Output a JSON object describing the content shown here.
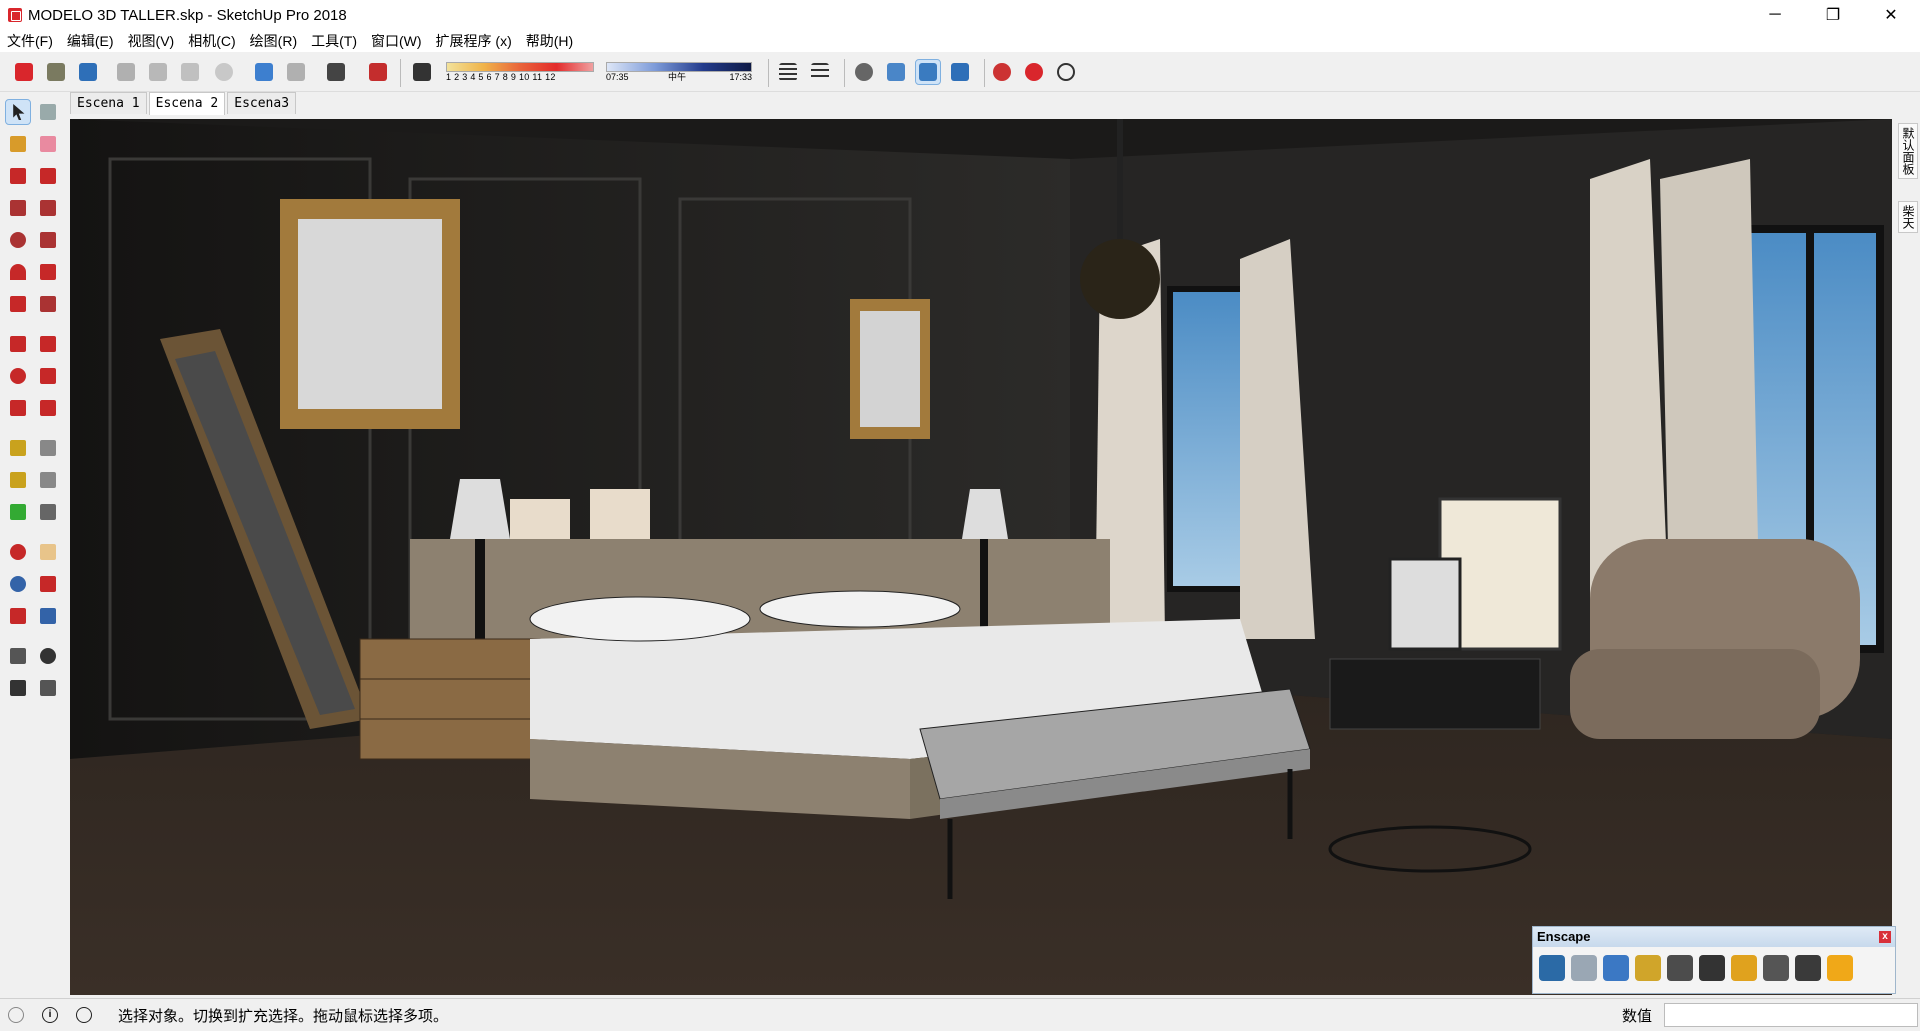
{
  "app": {
    "title": "MODELO 3D TALLER.skp - SketchUp Pro 2018"
  },
  "window_controls": {
    "minimize": "─",
    "maximize": "❐",
    "close": "✕"
  },
  "menu": [
    {
      "label": "文件(F)"
    },
    {
      "label": "编辑(E)"
    },
    {
      "label": "视图(V)"
    },
    {
      "label": "相机(C)"
    },
    {
      "label": "绘图(R)"
    },
    {
      "label": "工具(T)"
    },
    {
      "label": "窗口(W)"
    },
    {
      "label": "扩展程序 (x)"
    },
    {
      "label": "帮助(H)"
    }
  ],
  "shadow": {
    "months": "1 2 3 4 5 6 7 8 9 10 11 12",
    "time_start": "07:35",
    "time_mid": "中午",
    "time_end": "17:33"
  },
  "scenes": [
    {
      "label": "Escena 1",
      "active": false
    },
    {
      "label": "Escena 2",
      "active": true
    },
    {
      "label": "Escena3",
      "active": false
    }
  ],
  "right_panel": {
    "tab1": "默认面板",
    "tab2": "柴天"
  },
  "enscape": {
    "title": "Enscape",
    "close": "x",
    "icons": [
      "walk-icon",
      "sync-icon",
      "start-icon",
      "light-icon",
      "sound-icon",
      "render-icon",
      "add-asset-icon",
      "settings-icon",
      "feedback-icon",
      "license-icon"
    ]
  },
  "status": {
    "text": "选择对象。切换到扩充选择。拖动鼠标选择多项。",
    "measure_label": "数值",
    "measure_value": ""
  },
  "colors": {
    "accent_red": "#d9262c",
    "select_blue": "#cfe3f7"
  }
}
